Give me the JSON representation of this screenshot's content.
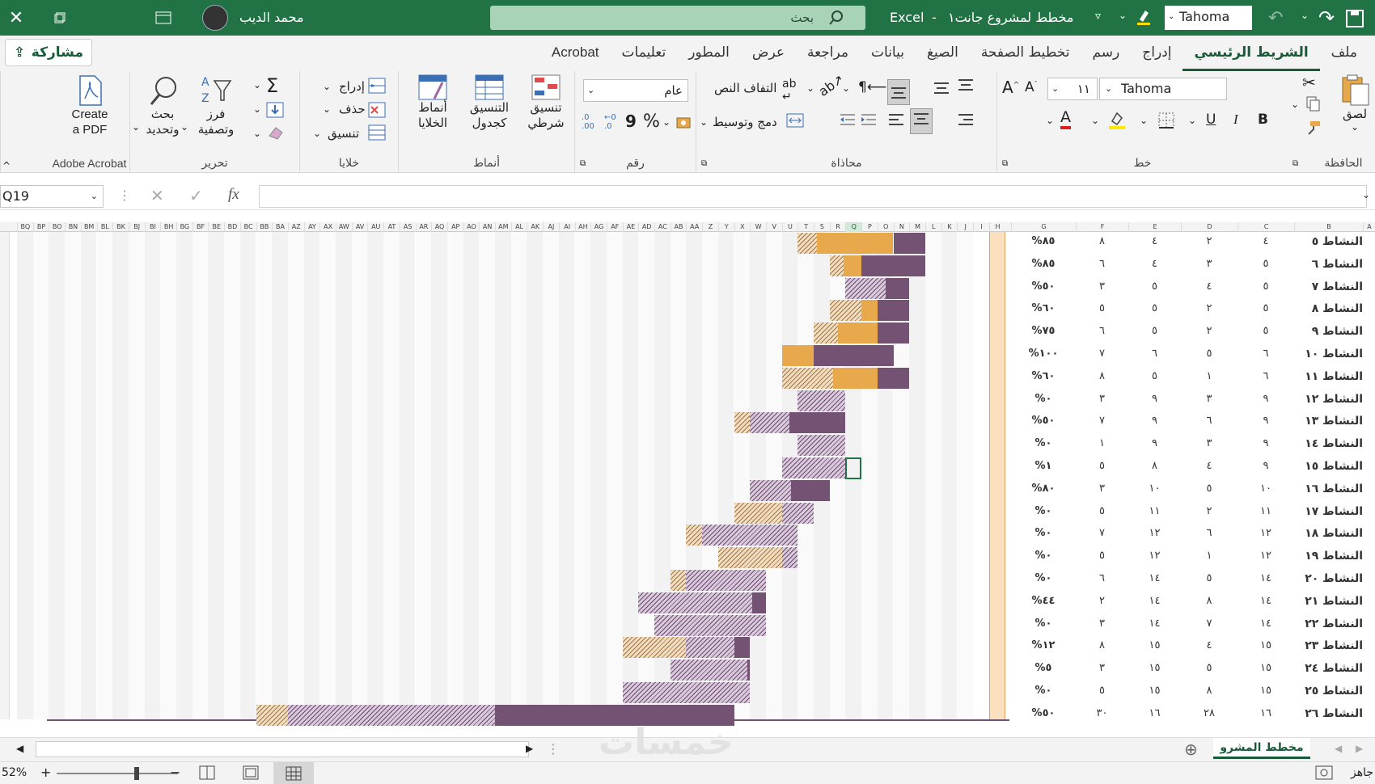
{
  "titlebar": {
    "font": "Tahoma",
    "app": "Excel",
    "file": "مخطط لمشروع جانت١",
    "search": "بحث",
    "user": "محمد الديب"
  },
  "tabs": [
    "ملف",
    "الشريط الرئيسي",
    "إدراج",
    "رسم",
    "تخطيط الصفحة",
    "الصيغ",
    "بيانات",
    "مراجعة",
    "عرض",
    "المطور",
    "تعليمات",
    "Acrobat"
  ],
  "active_tab": "الشريط الرئيسي",
  "share_label": "مشاركة",
  "ribbon": {
    "clipboard": {
      "paste": "لصق",
      "label": "الحافظة"
    },
    "font": {
      "name": "Tahoma",
      "size": "١١",
      "bold": "B",
      "italic": "I",
      "underline": "U",
      "label": "خط"
    },
    "alignment": {
      "wrap": "التفاف النص",
      "merge": "دمج وتوسيط",
      "label": "محاذاة"
    },
    "number": {
      "format": "عام",
      "percent": "%",
      "comma": "9",
      "dec_inc": ".00",
      "dec_dec": ".0",
      "label": "رقم"
    },
    "styles": {
      "conditional": "تنسيق\nشرطي",
      "table": "التنسيق\nكجدول",
      "cell": "أنماط\nالخلايا",
      "label": "أنماط"
    },
    "cells": {
      "insert": "إدراج",
      "delete": "حذف",
      "format": "تنسيق",
      "label": "خلايا"
    },
    "editing": {
      "sort": "فرز\nوتصفية",
      "find": "بحث\nوتحديد",
      "label": "تحرير"
    },
    "acrobat": {
      "create": "Create\na PDF",
      "label": "Adobe Acrobat"
    }
  },
  "namebox": "Q19",
  "fx": "fx",
  "columns": [
    "A",
    "B",
    "C",
    "D",
    "E",
    "F",
    "G",
    "H",
    "I",
    "J",
    "K",
    "L",
    "M",
    "N",
    "O",
    "P",
    "Q",
    "R",
    "S",
    "T",
    "U",
    "V",
    "W",
    "X",
    "Y",
    "Z",
    "AA",
    "AB",
    "AC",
    "AD",
    "AE",
    "AF",
    "AG",
    "AH",
    "AI",
    "AJ",
    "AK",
    "AL",
    "AM",
    "AN",
    "AO",
    "AP",
    "AQ",
    "AR",
    "AS",
    "AT",
    "AU",
    "AV",
    "AW",
    "AX",
    "AY",
    "AZ",
    "BA",
    "BB",
    "BC",
    "BD",
    "BE",
    "BF",
    "BG",
    "BH",
    "BI",
    "BJ",
    "BK",
    "BL",
    "BM",
    "BN",
    "BO",
    "BP",
    "BQ"
  ],
  "rows": [
    {
      "name": "النشاط ٥",
      "c": "٤",
      "d": "٢",
      "e": "٤",
      "f": "٨",
      "g": "٨٥%"
    },
    {
      "name": "النشاط ٦",
      "c": "٥",
      "d": "٣",
      "e": "٤",
      "f": "٦",
      "g": "٨٥%"
    },
    {
      "name": "النشاط ٧",
      "c": "٥",
      "d": "٤",
      "e": "٥",
      "f": "٣",
      "g": "٥٠%"
    },
    {
      "name": "النشاط ٨",
      "c": "٥",
      "d": "٢",
      "e": "٥",
      "f": "٥",
      "g": "٦٠%"
    },
    {
      "name": "النشاط ٩",
      "c": "٥",
      "d": "٢",
      "e": "٥",
      "f": "٦",
      "g": "٧٥%"
    },
    {
      "name": "النشاط ١٠",
      "c": "٦",
      "d": "٥",
      "e": "٦",
      "f": "٧",
      "g": "١٠٠%"
    },
    {
      "name": "النشاط ١١",
      "c": "٦",
      "d": "١",
      "e": "٥",
      "f": "٨",
      "g": "٦٠%"
    },
    {
      "name": "النشاط ١٢",
      "c": "٩",
      "d": "٣",
      "e": "٩",
      "f": "٣",
      "g": "٠%"
    },
    {
      "name": "النشاط ١٣",
      "c": "٩",
      "d": "٦",
      "e": "٩",
      "f": "٧",
      "g": "٥٠%"
    },
    {
      "name": "النشاط ١٤",
      "c": "٩",
      "d": "٣",
      "e": "٩",
      "f": "١",
      "g": "٠%"
    },
    {
      "name": "النشاط ١٥",
      "c": "٩",
      "d": "٤",
      "e": "٨",
      "f": "٥",
      "g": "١%"
    },
    {
      "name": "النشاط ١٦",
      "c": "١٠",
      "d": "٥",
      "e": "١٠",
      "f": "٣",
      "g": "٨٠%"
    },
    {
      "name": "النشاط ١٧",
      "c": "١١",
      "d": "٢",
      "e": "١١",
      "f": "٥",
      "g": "٠%"
    },
    {
      "name": "النشاط ١٨",
      "c": "١٢",
      "d": "٦",
      "e": "١٢",
      "f": "٧",
      "g": "٠%"
    },
    {
      "name": "النشاط ١٩",
      "c": "١٢",
      "d": "١",
      "e": "١٢",
      "f": "٥",
      "g": "٠%"
    },
    {
      "name": "النشاط ٢٠",
      "c": "١٤",
      "d": "٥",
      "e": "١٤",
      "f": "٦",
      "g": "٠%"
    },
    {
      "name": "النشاط ٢١",
      "c": "١٤",
      "d": "٨",
      "e": "١٤",
      "f": "٢",
      "g": "٤٤%"
    },
    {
      "name": "النشاط ٢٢",
      "c": "١٤",
      "d": "٧",
      "e": "١٤",
      "f": "٣",
      "g": "٠%"
    },
    {
      "name": "النشاط ٢٣",
      "c": "١٥",
      "d": "٤",
      "e": "١٥",
      "f": "٨",
      "g": "١٢%"
    },
    {
      "name": "النشاط ٢٤",
      "c": "١٥",
      "d": "٥",
      "e": "١٥",
      "f": "٣",
      "g": "٥%"
    },
    {
      "name": "النشاط ٢٥",
      "c": "١٥",
      "d": "٨",
      "e": "١٥",
      "f": "٥",
      "g": "٠%"
    },
    {
      "name": "النشاط ٢٦",
      "c": "١٦",
      "d": "٢٨",
      "e": "١٦",
      "f": "٣٠",
      "g": "٥٠%"
    }
  ],
  "sheet_tab": "مخطط المشرو",
  "status": {
    "ready": "جاهز",
    "zoom": "52%"
  },
  "watermark": "خمسات",
  "colors": {
    "ribbon_green": "#217346",
    "plan_hatch": "#d9c9dc",
    "actual_solid": "#745274",
    "over_hatch": "#f1dcc0",
    "over_solid": "#e8a84c",
    "today_col": "#fbe0bf"
  }
}
